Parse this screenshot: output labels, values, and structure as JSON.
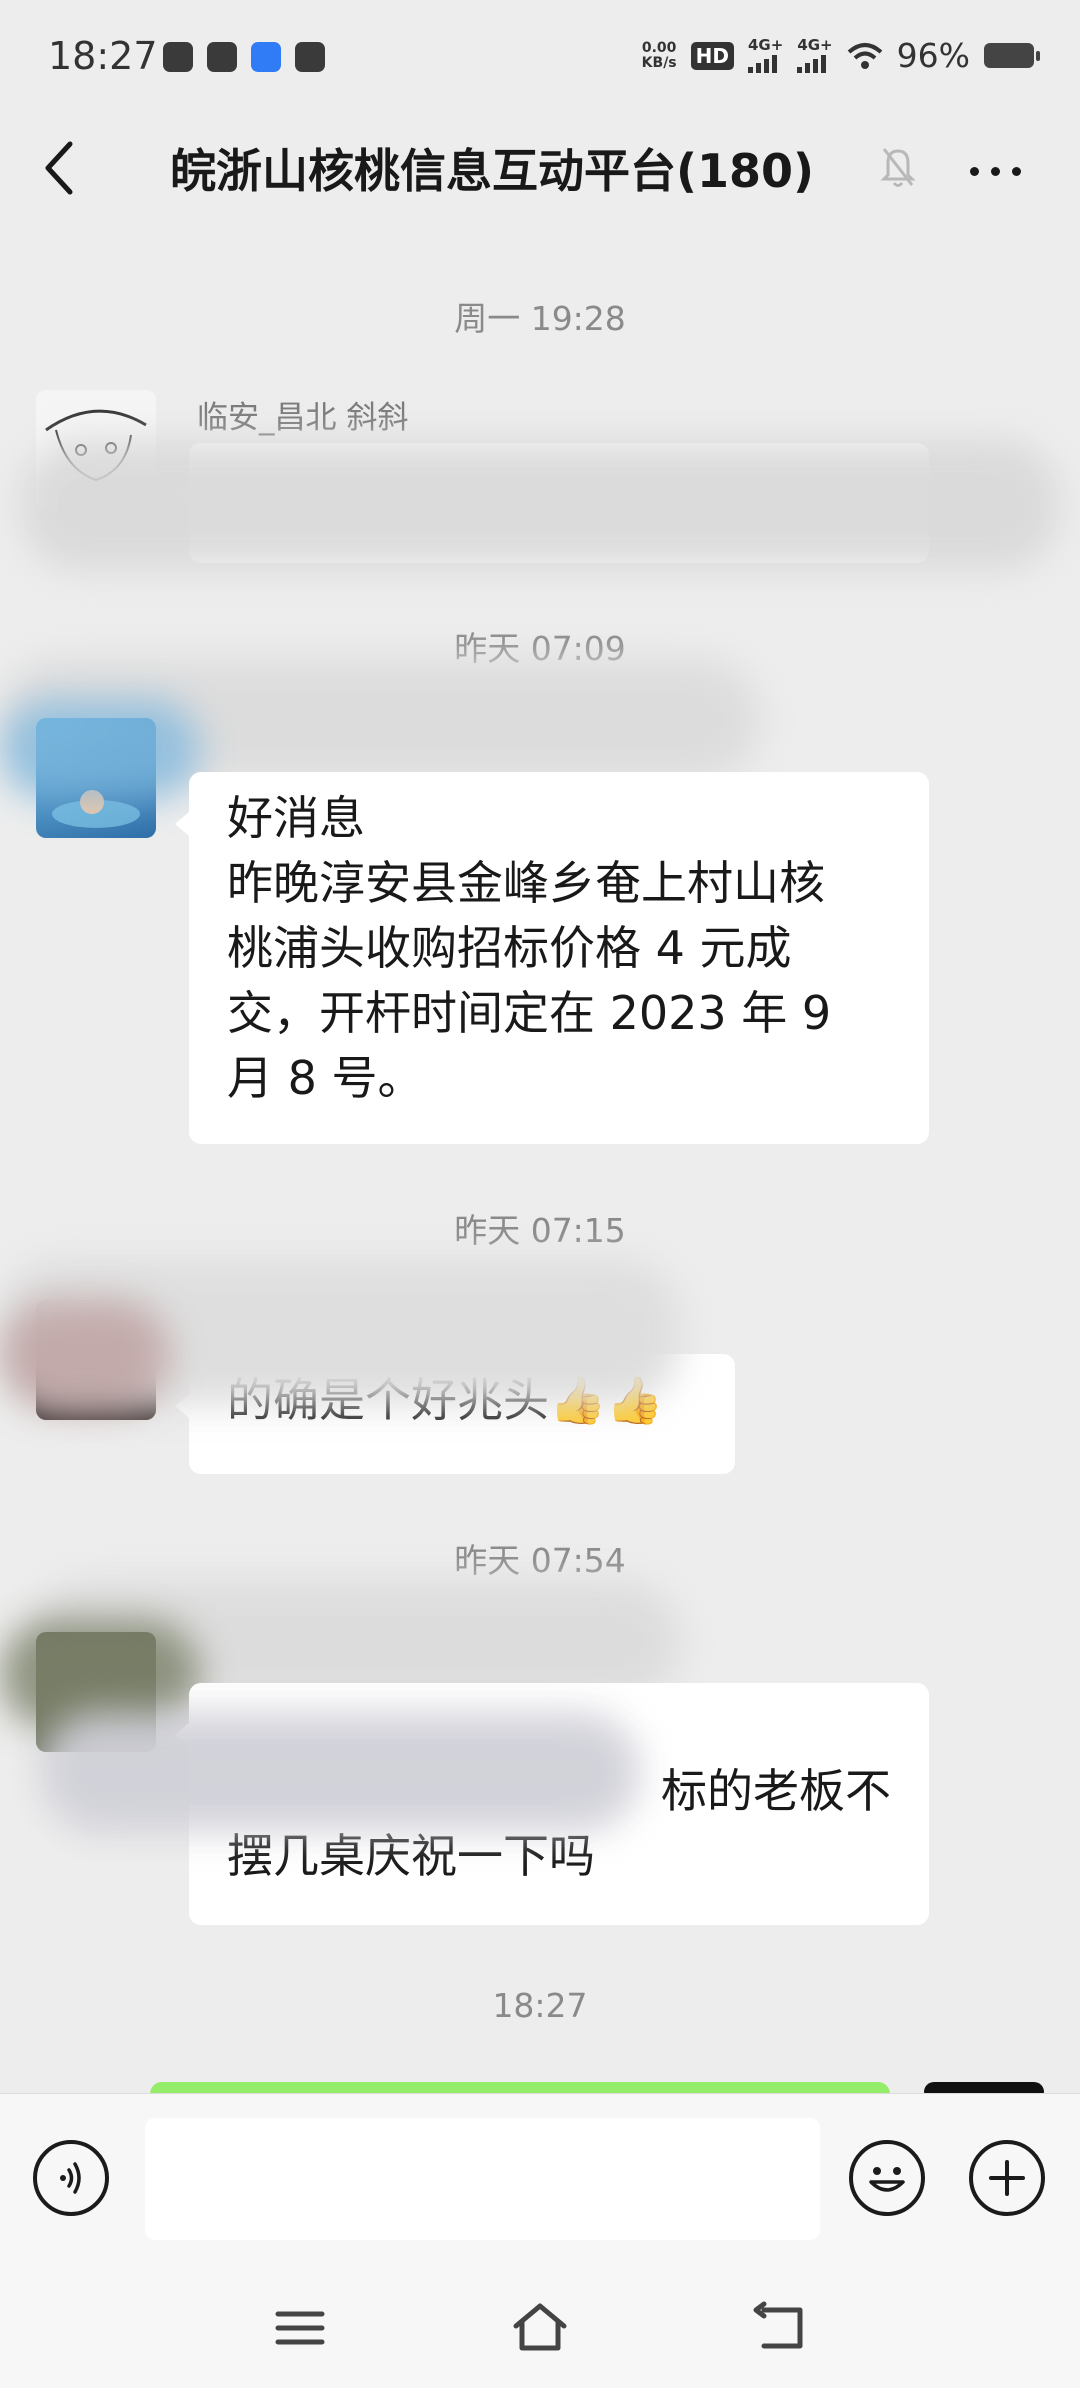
{
  "status_bar": {
    "time": "18:27",
    "network_speed": "0.00\nKB/s",
    "hd_badge": "HD",
    "signal_1_label": "4G+",
    "signal_2_label": "4G+",
    "battery": "96%",
    "icons_left": [
      "weibo-icon",
      "message-icon",
      "translate-icon",
      "play-icon"
    ],
    "icons_right": [
      "hd-voice-icon",
      "signal-icon",
      "signal-icon",
      "wifi-icon",
      "battery-icon"
    ]
  },
  "nav": {
    "title": "皖浙山核桃信息互动平台(180)",
    "icons": [
      "back-arrow-icon",
      "mute-bell-icon",
      "more-icon"
    ]
  },
  "messages": [
    {
      "type": "timestamp",
      "text": "周一 19:28"
    },
    {
      "type": "incoming",
      "sender": "临安_昌北  斜斜",
      "text": ""
    },
    {
      "type": "timestamp",
      "text": "昨天 07:09"
    },
    {
      "type": "incoming",
      "sender": "",
      "lines": [
        "好消息",
        "昨晚淳安县金峰乡奄上村山核",
        "桃浦头收购招标价格 4 元成",
        "交，开杆时间定在 2023 年 9",
        "月 8 号。"
      ]
    },
    {
      "type": "timestamp",
      "text": "昨天 07:15"
    },
    {
      "type": "incoming",
      "sender": "",
      "text": "的确是个好兆头👍👍"
    },
    {
      "type": "timestamp",
      "text": "昨天 07:54"
    },
    {
      "type": "incoming",
      "sender": "",
      "lines": [
        "标的老板不",
        "摆几桌庆祝一下吗"
      ]
    },
    {
      "type": "timestamp",
      "text": "18:27"
    },
    {
      "type": "outgoing",
      "text": ""
    }
  ],
  "input_bar": {
    "placeholder": "",
    "icons": [
      "voice-icon",
      "emoji-icon",
      "plus-icon"
    ]
  },
  "system_nav": {
    "icons": [
      "menu-icon",
      "home-icon",
      "back-icon"
    ]
  },
  "colors": {
    "background": "#ededed",
    "bubble_incoming": "#ffffff",
    "bubble_outgoing": "#95ec69",
    "timestamp": "#8a8a8a"
  }
}
